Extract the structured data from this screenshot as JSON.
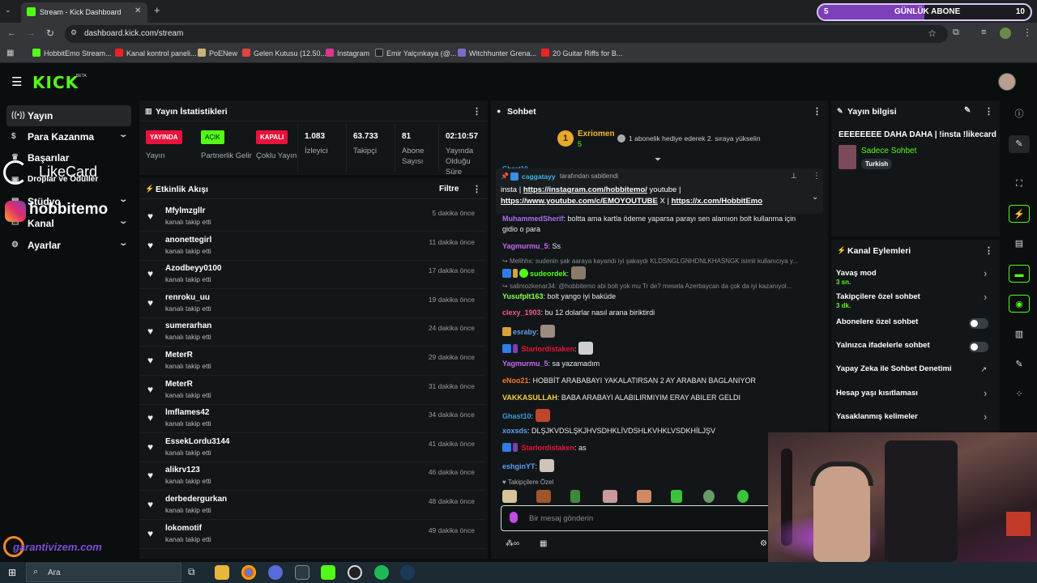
{
  "browser": {
    "tab_title": "Stream - Kick Dashboard",
    "url": "dashboard.kick.com/stream",
    "bookmarks": [
      "HobbitEmo Stream...",
      "Kanal kontrol paneli...",
      "PoENew",
      "Gelen Kutusu (12.50...",
      "Instagram",
      "Emir Yalçınkaya (@...",
      "Witchhunter Grena...",
      "20 Guitar Riffs for B..."
    ],
    "subgoal": {
      "count": "5",
      "label": "GÜNLÜK ABONE",
      "target": "10"
    }
  },
  "header": {
    "logo": "KICK",
    "beta": "BETA"
  },
  "sidebar": {
    "items": [
      {
        "label": "Yayın",
        "icon": "broadcast-icon"
      },
      {
        "label": "Para Kazanma",
        "icon": "dollar-icon"
      },
      {
        "label": "Başarılar",
        "icon": "trophy-icon"
      },
      {
        "label": "Droplar ve Ödüller",
        "icon": "gift-icon"
      },
      {
        "label": "Stüdyo",
        "icon": "studio-icon"
      },
      {
        "label": "Kanal",
        "icon": "channel-icon"
      },
      {
        "label": "Ayarlar",
        "icon": "settings-icon"
      }
    ],
    "overlay_likecard": "LikeCard",
    "overlay_handle": "hobbitemo",
    "overlay_sponsor": "garantivizem.com"
  },
  "stats": {
    "title": "Yayın İstatistikleri",
    "yayinda": "YAYINDA",
    "yayin_lbl": "Yayın",
    "acik": "AÇIK",
    "partnerlik_lbl": "Partnerlik Gelir",
    "kapali": "KAPALI",
    "coklu_lbl": "Çoklu Yayın",
    "viewers": "1.083",
    "viewers_lbl": "İzleyici",
    "followers": "63.733",
    "followers_lbl": "Takipçi",
    "subs": "81",
    "subs_lbl": "Abone Sayısı",
    "uptime": "02:10:57",
    "uptime_lbl": "Yayında Olduğu Süre"
  },
  "events": {
    "title": "Etkinlik Akışı",
    "filter": "Filtre",
    "sub_text": "kanalı takip etti",
    "rows": [
      {
        "name": "Mfylmzgllr",
        "time": "5 dakika önce"
      },
      {
        "name": "anonettegirl",
        "time": "11 dakika önce"
      },
      {
        "name": "Azodbeyy0100",
        "time": "17 dakika önce"
      },
      {
        "name": "renroku_uu",
        "time": "19 dakika önce"
      },
      {
        "name": "sumerarhan",
        "time": "24 dakika önce"
      },
      {
        "name": "MeterR",
        "time": "29 dakika önce"
      },
      {
        "name": "MeterR",
        "time": "31 dakika önce"
      },
      {
        "name": "lmflames42",
        "time": "34 dakika önce"
      },
      {
        "name": "EssekLordu3144",
        "time": "41 dakika önce"
      },
      {
        "name": "alikrv123",
        "time": "46 dakika önce"
      },
      {
        "name": "derbedergurkan",
        "time": "48 dakika önce"
      },
      {
        "name": "lokomotif",
        "time": "49 dakika önce"
      }
    ]
  },
  "chat": {
    "title": "Sohbet",
    "top_gifter": {
      "rank": "1",
      "name": "Exriomen",
      "count": "5"
    },
    "gift_notice": "1 abonelik hediye ederek 2. sıraya yükselin",
    "pinned_by": "caggatayy",
    "pinned_suffix": "tarafından sabitlendi",
    "pinned_text_1": "insta | ",
    "pinned_link_1": "https://instagram.com/hobbitemo/",
    "pinned_text_2": " youtube |",
    "pinned_link_2": "https://www.youtube.com/c/EMOYOUTUBE",
    "pinned_text_3": " X | ",
    "pinned_link_3": "https://x.com/HobbitEmo",
    "partial_user": "Ghast10",
    "m1_user": "MuhammedSherif",
    "m1_text": "boltta ama kartla ödeme yaparsa parayı sen alamıon bolt kullanma için",
    "m1_text2": "gidio o para",
    "m2_user": "Yagmurmu_5",
    "m2_text": "Ss",
    "r1": "Melihhx: sudenin şak aaraya kayandı iyi şakaydı KLDSNGLGNHDNLKHASNGK isimli kullanıcıya y...",
    "m3_user": "sudeordek",
    "r2": "salimozkenar34: @hobbitemo abi bolt yok mu Tr de? mesela Azerbaycan da çok da iyi kazanıyol...",
    "m4_user": "Yusufplt163",
    "m4_text": "bolt yango iyi baküde",
    "m5_user": "clexy_1903",
    "m5_text": "bu 12 dolarlar nasıl arana biriktirdi",
    "m6_user": "esraby",
    "m7_user": "Starlordistaken",
    "m8_user": "Yagmurmu_5",
    "m8_text": "sa yazamadım",
    "m9_user": "eNoo21",
    "m9_text": "HOBBİT ARABABAYI YAKALATIRSAN 2 AY ARABAN BAGLANIYOR",
    "m10_user": "VAKKASULLAH",
    "m10_text": "BABA ARABAYI ALABILIRMIYIM ERAY ABILER GELDI",
    "m11_user": "Ghast10",
    "m12_user": "xoxsds",
    "m12_text": "DLŞJKVDSLŞKJHVSDHKLİVDSHLKVHKLVSDKHİLJŞV",
    "m13_user": "Starlordistaken",
    "m13_text": "as",
    "m14_user": "eshginYT",
    "followers_only": "Takipçilere Özel",
    "input_placeholder": "Bir mesaj gönderin"
  },
  "stream_info": {
    "title": "Yayın bilgisi",
    "stream_title": "EEEEEEEE DAHA DAHA | !insta !likecard",
    "category": "Sadece Sohbet",
    "language": "Turkish"
  },
  "channel_actions": {
    "title": "Kanal Eylemleri",
    "items": [
      {
        "label": "Yavaş mod",
        "sub": "3 sn.",
        "kind": "arrow"
      },
      {
        "label": "Takipçilere özel sohbet",
        "sub": "3 dk.",
        "kind": "arrow"
      },
      {
        "label": "Abonelere özel sohbet",
        "sub": "",
        "kind": "toggle"
      },
      {
        "label": "Yalnızca ifadelerle sohbet",
        "sub": "",
        "kind": "toggle"
      },
      {
        "label": "Yapay Zeka ile Sohbet Denetimi",
        "sub": "",
        "kind": "external"
      },
      {
        "label": "Hesap yaşı kısıtlaması",
        "sub": "",
        "kind": "arrow"
      },
      {
        "label": "Yasaklanmış kelimeler",
        "sub": "",
        "kind": "arrow"
      }
    ]
  },
  "taskbar": {
    "search_placeholder": "Ara"
  },
  "colors": {
    "kick_green": "#53fc18",
    "live_red": "#e8123a",
    "bg": "#0b0e0f",
    "panel": "#131618"
  }
}
